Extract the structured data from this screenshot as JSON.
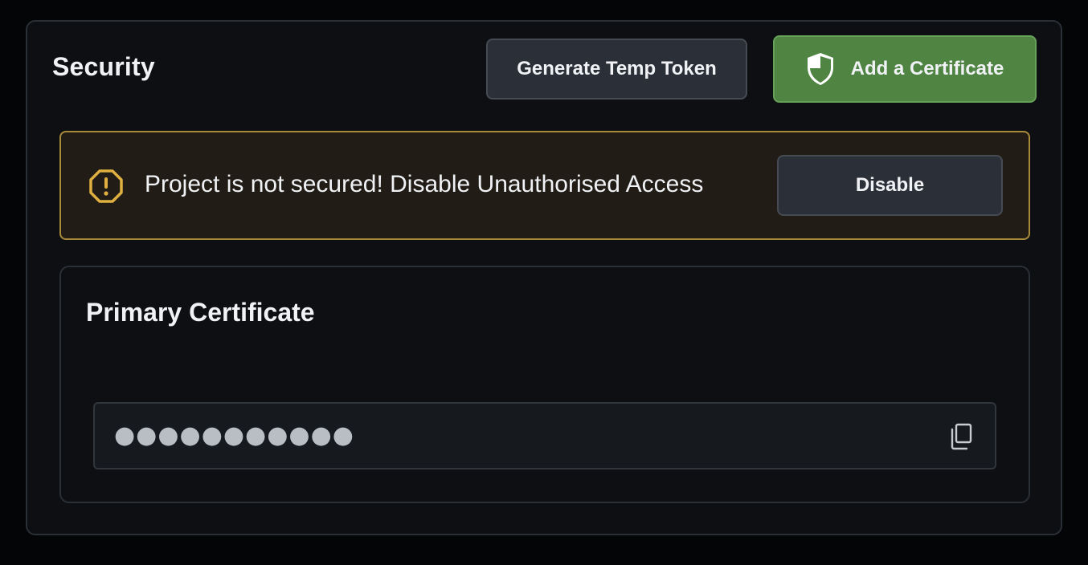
{
  "security": {
    "title": "Security",
    "generate_token_label": "Generate Temp Token",
    "add_certificate_label": "Add a Certificate"
  },
  "alert": {
    "message": "Project is not secured! Disable Unauthorised Access",
    "disable_label": "Disable"
  },
  "certificate": {
    "title": "Primary Certificate",
    "masked_value": "●●●●●●●●●●●"
  },
  "icons": {
    "shield": "shield-icon",
    "warning": "warning-octagon-icon",
    "copy": "copy-icon"
  },
  "colors": {
    "accent_green": "#4f8442",
    "warning_border": "#a78a3a",
    "warning_icon": "#e0b040"
  }
}
